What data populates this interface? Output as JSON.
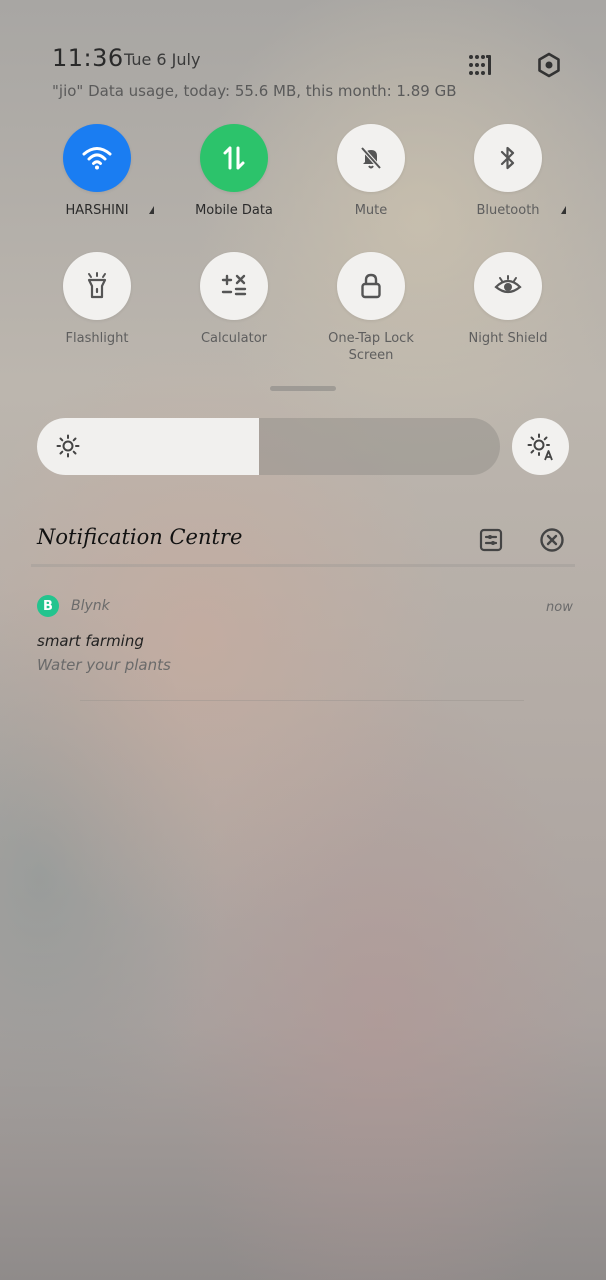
{
  "status": {
    "time": "11:36",
    "date": "Tue 6 July",
    "data_usage": "\"jio\" Data usage, today: 55.6 MB, this month: 1.89 GB"
  },
  "header_icons": [
    "grid-menu-icon",
    "settings-icon"
  ],
  "tiles": [
    {
      "label": "HARSHINI",
      "icon": "wifi-icon",
      "active": true,
      "color": "#1a7df2",
      "has_expand": true
    },
    {
      "label": "Mobile Data",
      "icon": "mobile-data-icon",
      "active": true,
      "color": "#2cc36b",
      "has_expand": false
    },
    {
      "label": "Mute",
      "icon": "mute-bell-icon",
      "active": false,
      "has_expand": false
    },
    {
      "label": "Bluetooth",
      "icon": "bluetooth-icon",
      "active": false,
      "has_expand": true
    },
    {
      "label": "Flashlight",
      "icon": "flashlight-icon",
      "active": false
    },
    {
      "label": "Calculator",
      "icon": "calculator-icon",
      "active": false
    },
    {
      "label": "One-Tap Lock",
      "label2": "Screen",
      "icon": "lock-icon",
      "active": false
    },
    {
      "label": "Night Shield",
      "icon": "eye-icon",
      "active": false
    }
  ],
  "brightness": {
    "level": 0.48,
    "auto_icon": "auto-brightness-icon"
  },
  "notification_centre": {
    "title": "Notification Centre",
    "notifications": [
      {
        "app_initial": "B",
        "app_name": "Blynk",
        "time": "now",
        "title": "smart farming",
        "text": "Water your plants"
      }
    ]
  },
  "colors": {
    "wifi_active": "#1a7df2",
    "data_active": "#2cc36b",
    "blynk": "#23c48e"
  }
}
